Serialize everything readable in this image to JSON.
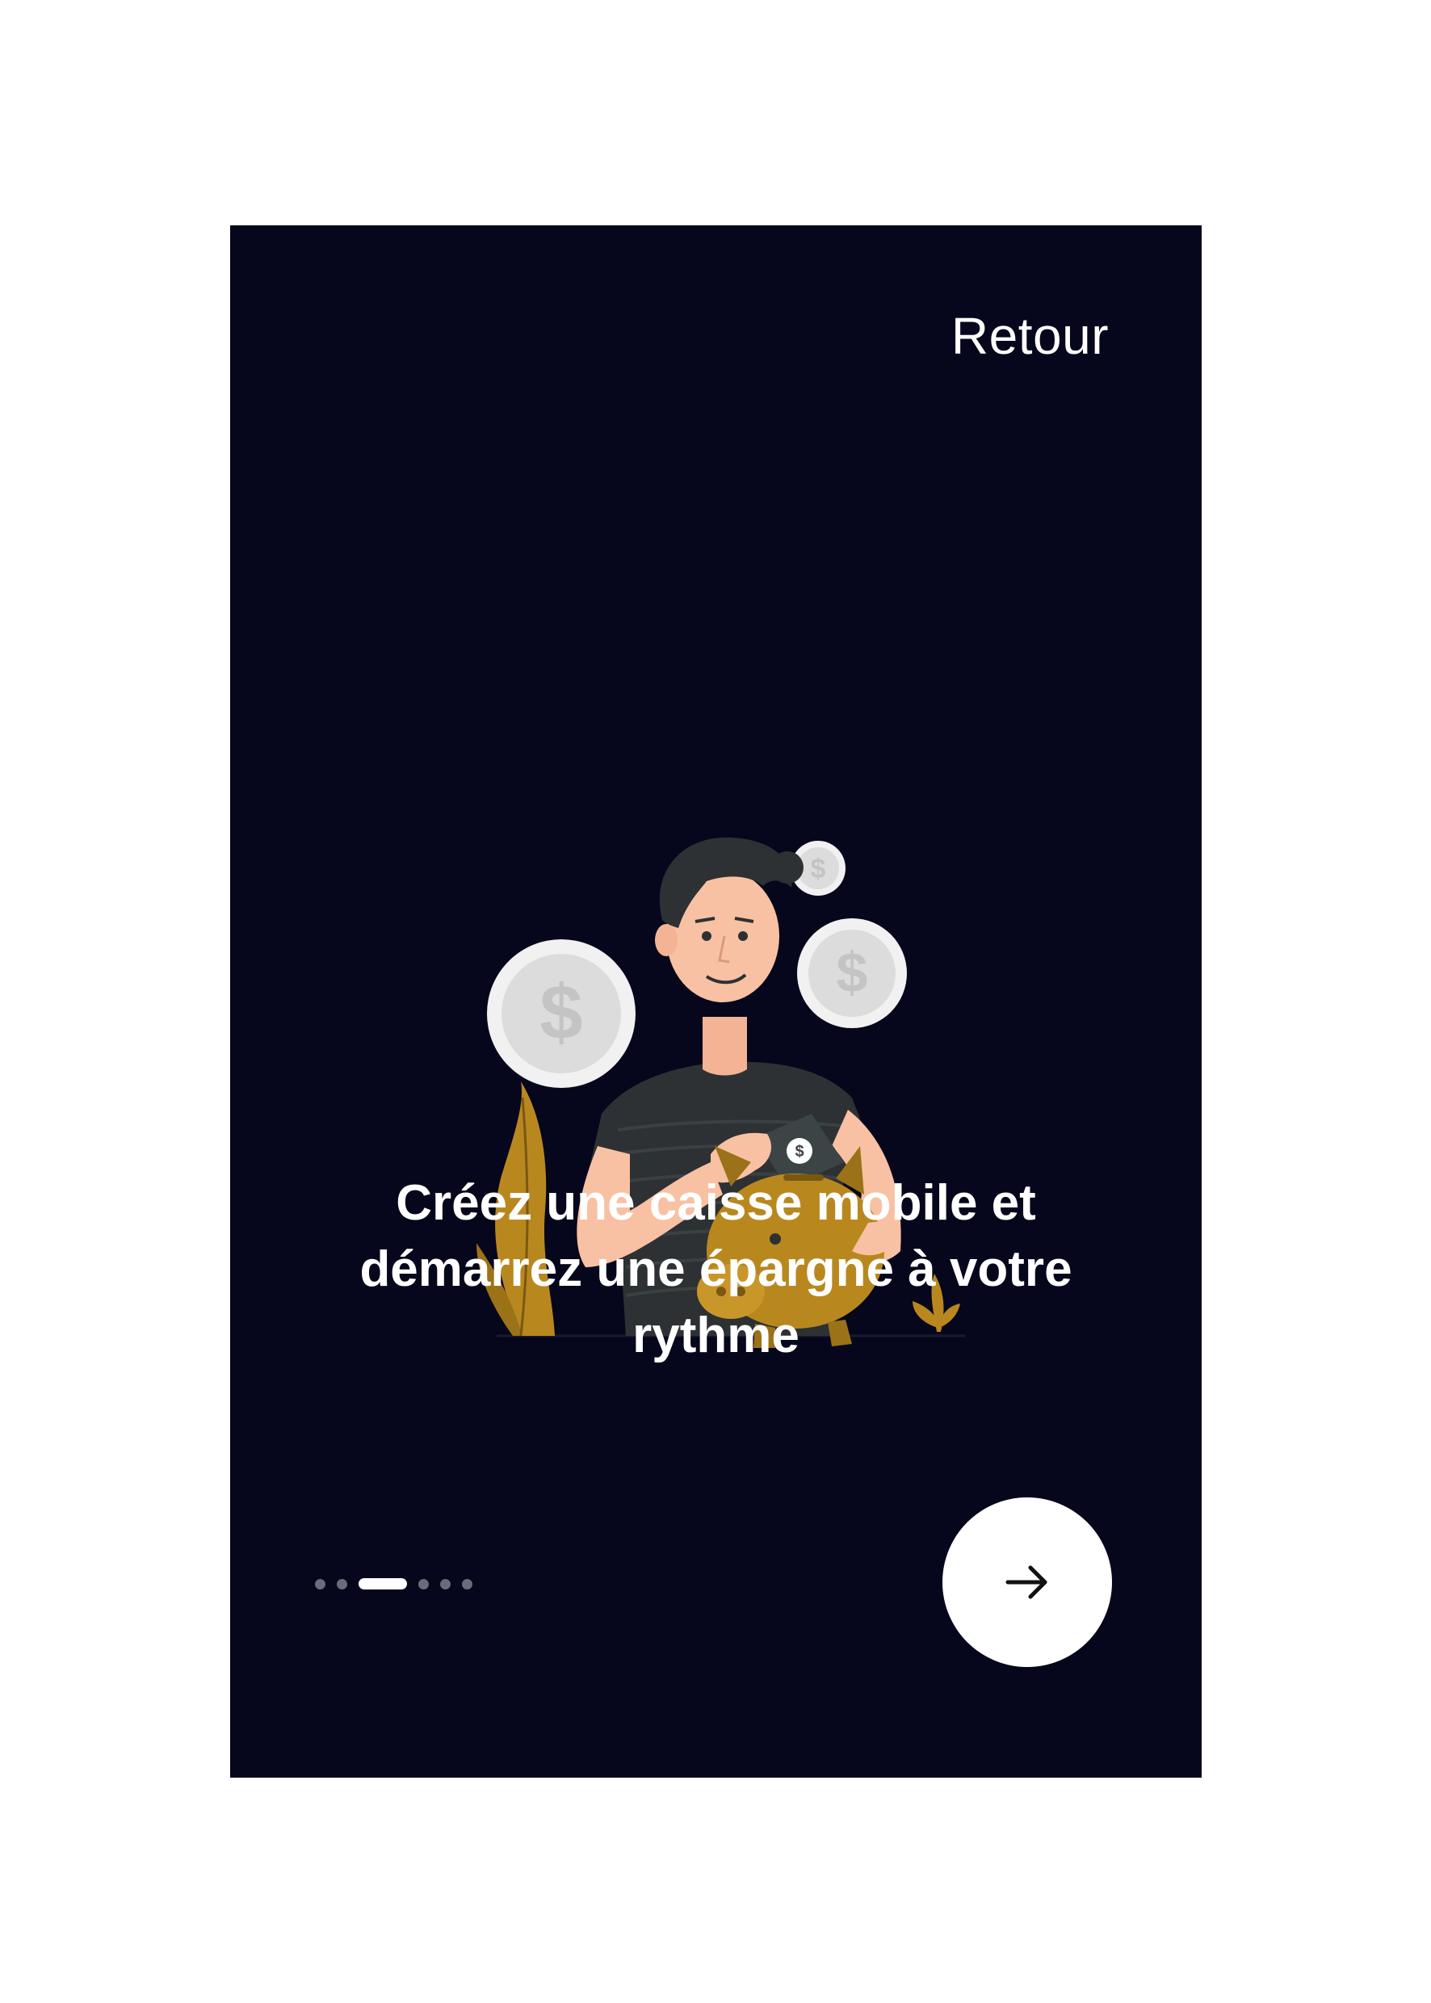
{
  "header": {
    "back_label": "Retour"
  },
  "illustration": {
    "icon": "person-piggy-bank-illustration",
    "coin_symbol": "$"
  },
  "onboarding": {
    "headline_line1": "Créez une caisse mobile et",
    "headline_line2": "démarrez une épargne à votre",
    "headline_line3": "rythme"
  },
  "pager": {
    "total": 6,
    "active_index": 2
  },
  "next_button": {
    "icon": "arrow-right-icon"
  },
  "colors": {
    "background": "#06061c",
    "accent_gold": "#b8881f",
    "text": "#ffffff"
  }
}
